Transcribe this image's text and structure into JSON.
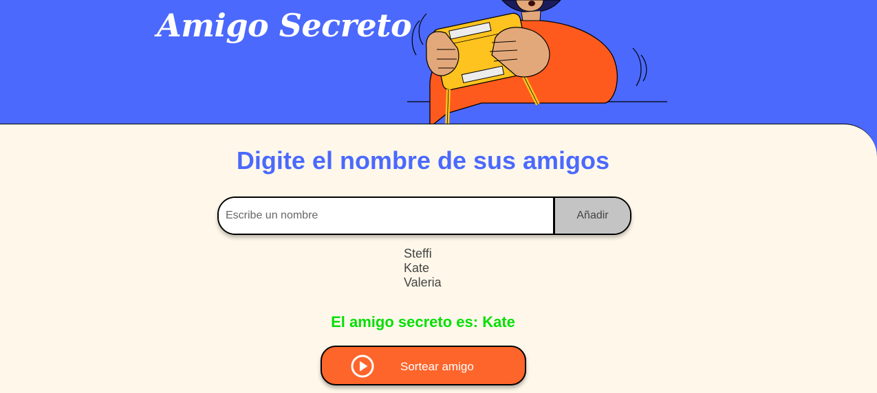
{
  "header": {
    "title": "Amigo Secreto",
    "illustration": "person-holding-gift-box"
  },
  "main": {
    "heading": "Digite el nombre de sus amigos",
    "input": {
      "placeholder": "Escribe un nombre",
      "value": ""
    },
    "add_button_label": "Añadir",
    "friends": [
      "Steffi",
      "Kate",
      "Valeria"
    ],
    "result_text": "El amigo secreto es: Kate",
    "draw_button": {
      "label": "Sortear amigo",
      "icon": "play-circle-icon"
    }
  },
  "colors": {
    "primary_blue": "#4b69fd",
    "background_cream": "#fff8ea",
    "accent_orange": "#fe652b",
    "result_green": "#05df05",
    "add_button_gray": "#c4c4c4"
  }
}
